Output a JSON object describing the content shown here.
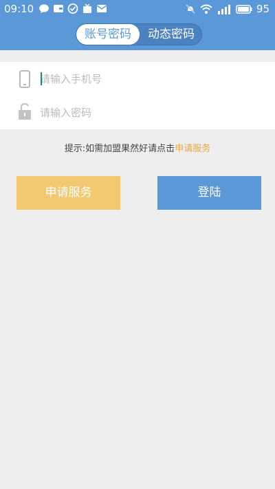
{
  "status_bar": {
    "time": "09:10",
    "battery": "95"
  },
  "login_tabs": {
    "account_password": "账号密码",
    "dynamic_password": "动态密码",
    "active": "account_password"
  },
  "form": {
    "phone_placeholder": "请输入手机号",
    "phone_value": "",
    "password_placeholder": "请输入密码",
    "password_value": ""
  },
  "hint": {
    "prefix": "提示:如需加盟果然好请点击",
    "link": "申请服务"
  },
  "buttons": {
    "apply": "申请服务",
    "login": "登陆"
  },
  "colors": {
    "primary": "#5b98d8",
    "accent": "#f2c871",
    "link": "#e8a93a",
    "background": "#eeeeee"
  }
}
